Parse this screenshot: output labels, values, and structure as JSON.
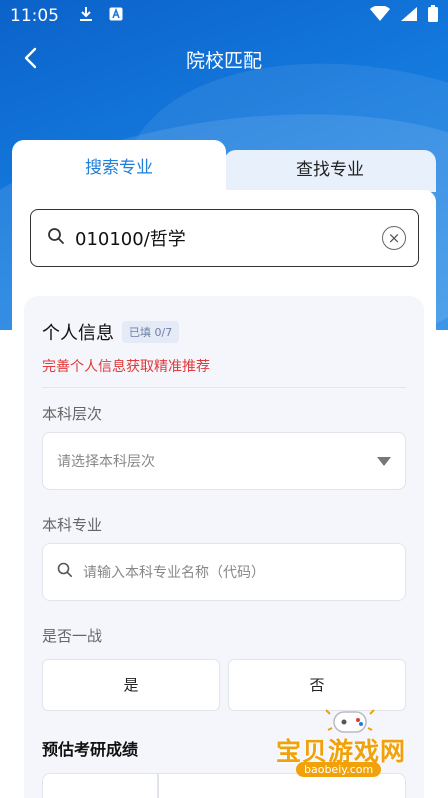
{
  "status_bar": {
    "time": "11:05"
  },
  "nav": {
    "title": "院校匹配"
  },
  "tabs": [
    {
      "label": "搜索专业",
      "active": true
    },
    {
      "label": "查找专业",
      "active": false
    }
  ],
  "search": {
    "value": "010100/哲学"
  },
  "info": {
    "title": "个人信息",
    "badge": "已填 0/7",
    "hint": "完善个人信息获取精准推荐",
    "level_label": "本科层次",
    "level_placeholder": "请选择本科层次",
    "major_label": "本科专业",
    "major_placeholder": "请输入本科专业名称（代码）",
    "first_try_label": "是否一战",
    "yes": "是",
    "no": "否",
    "score_title": "预估考研成绩"
  },
  "watermark": {
    "text": "宝贝游戏网",
    "url": "baobeiy.com"
  },
  "colors": {
    "primary": "#1f7fd9",
    "hint_red": "#e03a3a",
    "hero_blue": "#0b62c9"
  }
}
